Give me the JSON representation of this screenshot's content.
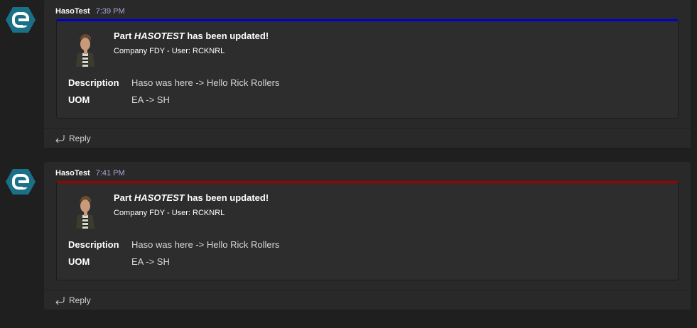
{
  "messages": [
    {
      "sender": "HasoTest",
      "time": "7:39 PM",
      "accent_color": "#0000cc",
      "avatar_icon": "hexagon-e-logo-icon",
      "card": {
        "title_prefix": "Part ",
        "title_part": "HASOTEST",
        "title_suffix": " has been updated!",
        "subtitle": "Company FDY - User: RCKNRL",
        "facts": [
          {
            "key": "Description",
            "value": "Haso was here -> Hello Rick Rollers"
          },
          {
            "key": "UOM",
            "value": "EA -> SH"
          }
        ]
      },
      "reply_label": "Reply"
    },
    {
      "sender": "HasoTest",
      "time": "7:41 PM",
      "accent_color": "#a00000",
      "avatar_icon": "hexagon-e-logo-icon",
      "card": {
        "title_prefix": "Part ",
        "title_part": "HASOTEST",
        "title_suffix": " has been updated!",
        "subtitle": "Company FDY - User: RCKNRL",
        "facts": [
          {
            "key": "Description",
            "value": "Haso was here -> Hello Rick Rollers"
          },
          {
            "key": "UOM",
            "value": "EA -> SH"
          }
        ]
      },
      "reply_label": "Reply"
    }
  ]
}
